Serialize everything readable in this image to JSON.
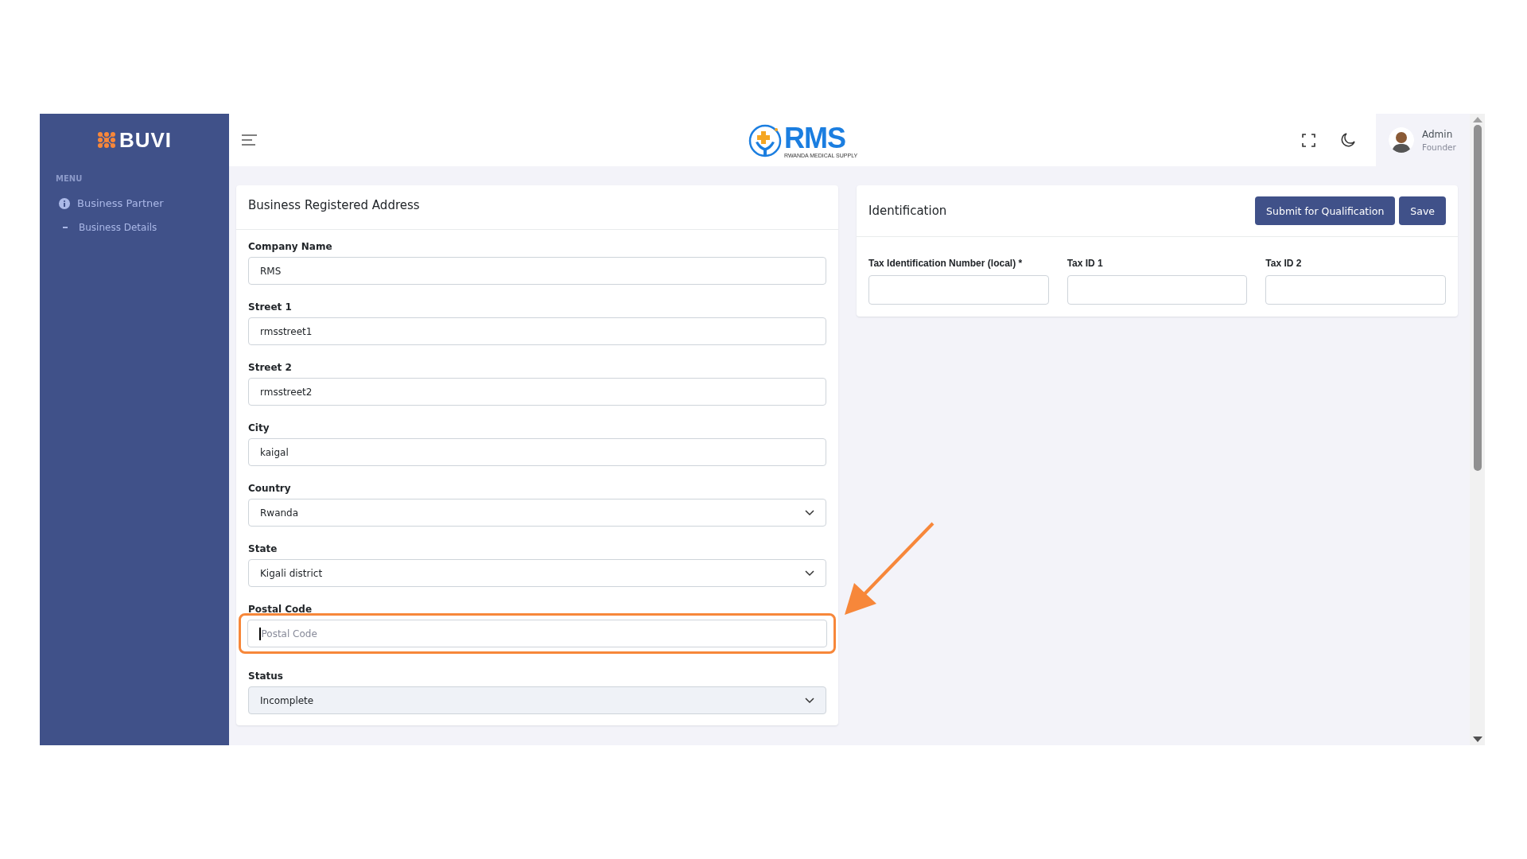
{
  "sidebar": {
    "logo": "BUVI",
    "menu_label": "MENU",
    "items": [
      {
        "label": "Business Partner",
        "children": [
          {
            "label": "Business Details"
          }
        ]
      }
    ]
  },
  "header": {
    "logo": "RMS",
    "logo_subtitle": "RWANDA MEDICAL SUPPLY",
    "user": {
      "name": "Admin",
      "role": "Founder"
    }
  },
  "address_card": {
    "title": "Business Registered Address",
    "fields": [
      {
        "label": "Company Name",
        "kind": "text",
        "value": "RMS",
        "disabled": false,
        "highlighted": false,
        "focused": false
      },
      {
        "label": "Street 1",
        "kind": "text",
        "value": "rmsstreet1",
        "disabled": false,
        "highlighted": false,
        "focused": false
      },
      {
        "label": "Street 2",
        "kind": "text",
        "value": "rmsstreet2",
        "disabled": false,
        "highlighted": false,
        "focused": false
      },
      {
        "label": "City",
        "kind": "text",
        "value": "kaigal",
        "disabled": false,
        "highlighted": false,
        "focused": false
      },
      {
        "label": "Country",
        "kind": "select",
        "value": "Rwanda",
        "disabled": false,
        "highlighted": false,
        "focused": false
      },
      {
        "label": "State",
        "kind": "select",
        "value": "Kigali district",
        "disabled": false,
        "highlighted": false,
        "focused": false
      },
      {
        "label": "Postal Code",
        "kind": "text",
        "placeholder": "Postal Code",
        "disabled": false,
        "highlighted": true,
        "focused": true
      },
      {
        "label": "Status",
        "kind": "select",
        "value": "Incomplete",
        "disabled": true,
        "highlighted": false,
        "focused": false
      }
    ]
  },
  "identification_card": {
    "title": "Identification",
    "buttons": [
      "Submit for Qualification",
      "Save"
    ],
    "fields": [
      {
        "label": "Tax Identification Number (local) *"
      },
      {
        "label": "Tax ID 1"
      },
      {
        "label": "Tax ID 2"
      }
    ]
  }
}
